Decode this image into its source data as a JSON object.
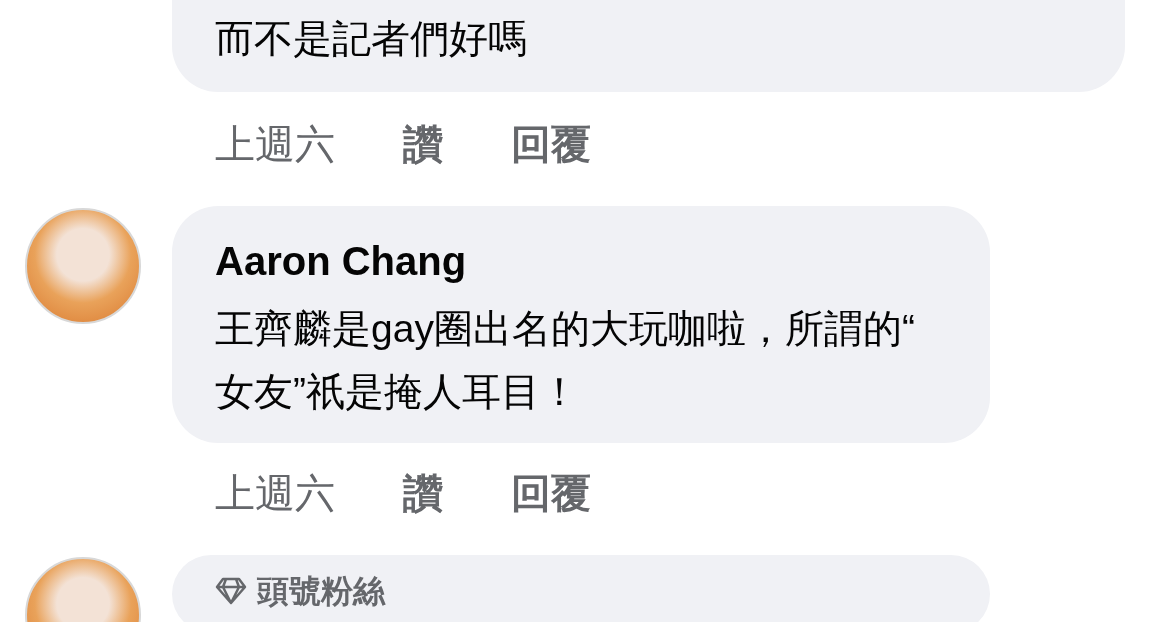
{
  "comments": [
    {
      "text": "而不是記者們好嗎",
      "time": "上週六",
      "like": "讚",
      "reply": "回覆"
    },
    {
      "avatar": true,
      "author": "Aaron Chang",
      "text": "王齊麟是gay圈出名的大玩咖啦，所謂的“\n女友”祇是掩人耳目！",
      "time": "上週六",
      "like": "讚",
      "reply": "回覆"
    },
    {
      "avatar": true,
      "badge": "頭號粉絲"
    }
  ]
}
